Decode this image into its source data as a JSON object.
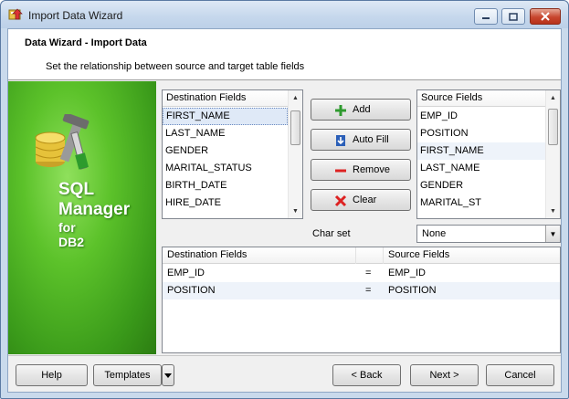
{
  "window": {
    "title": "Import Data Wizard"
  },
  "header": {
    "title": "Data Wizard - Import Data",
    "subtitle": "Set the relationship between source and target table fields"
  },
  "banner": {
    "line1": "SQL",
    "line2": "Manager",
    "line3": "for",
    "line4": "DB2"
  },
  "destination_list": {
    "header": "Destination Fields",
    "items": [
      "FIRST_NAME",
      "LAST_NAME",
      "GENDER",
      "MARITAL_STATUS",
      "BIRTH_DATE",
      "HIRE_DATE"
    ],
    "selected": "FIRST_NAME"
  },
  "source_list": {
    "header": "Source Fields",
    "items": [
      "EMP_ID",
      "POSITION",
      "FIRST_NAME",
      "LAST_NAME",
      "GENDER",
      "MARITAL_ST"
    ]
  },
  "actions": {
    "add": "Add",
    "auto_fill": "Auto Fill",
    "remove": "Remove",
    "clear": "Clear"
  },
  "charset": {
    "label": "Char set",
    "value": "None"
  },
  "mapping": {
    "headers": {
      "destination": "Destination Fields",
      "source": "Source Fields"
    },
    "rows": [
      {
        "destination": "EMP_ID",
        "op": "=",
        "source": "EMP_ID"
      },
      {
        "destination": "POSITION",
        "op": "=",
        "source": "POSITION"
      }
    ]
  },
  "footer": {
    "help": "Help",
    "templates": "Templates",
    "back": "< Back",
    "next": "Next >",
    "cancel": "Cancel"
  },
  "colors": {
    "banner_green": "#5cc22a",
    "selection": "#dfe9f7",
    "close_red": "#c7462e"
  }
}
